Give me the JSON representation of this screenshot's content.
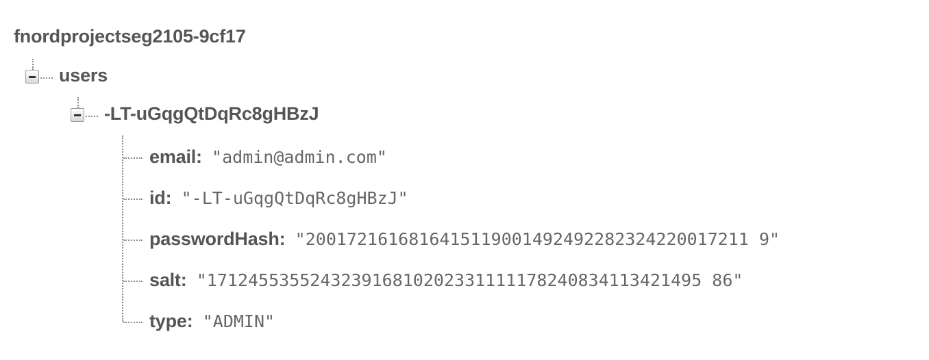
{
  "database": {
    "root_name": "fnordprojectseg2105-9cf17"
  },
  "tree": {
    "users_node": {
      "label": "users"
    },
    "user_node": {
      "label": "-LT-uGqgQtDqRc8gHBzJ"
    },
    "fields": [
      {
        "key": "email",
        "colon": ":",
        "value": "\"admin@admin.com\""
      },
      {
        "key": "id",
        "colon": ":",
        "value": "\"-LT-uGqgQtDqRc8gHBzJ\""
      },
      {
        "key": "passwordHash",
        "colon": ":",
        "value": "\"2001721616816415119001492492282324220017211 9\""
      },
      {
        "key": "salt",
        "colon": ":",
        "value": "\"171245535524323916810202331111178240834113421495 86\""
      },
      {
        "key": "type",
        "colon": ":",
        "value": "\"ADMIN\""
      }
    ]
  }
}
